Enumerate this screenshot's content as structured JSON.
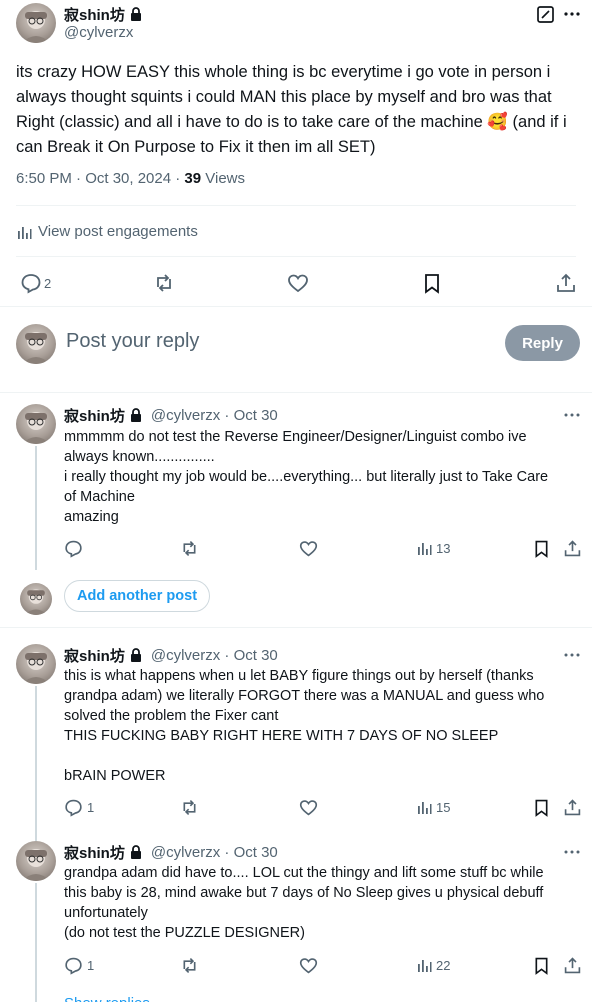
{
  "main_post": {
    "author_name": "寂shin坊",
    "author_handle": "@cylverzx",
    "text": "its crazy HOW EASY this whole thing is bc everytime i go vote in person i always thought squints i could MAN this place by myself and bro was that Right (classic) and all i have to do is to take care of the machine 🥰 (and if i can Break it On Purpose to Fix it then im all SET)",
    "timestamp": "6:50 PM · Oct 30, 2024 · ",
    "views_count": "39",
    "views_label": " Views",
    "engagements_label": "View post engagements",
    "reply_count": "2"
  },
  "composer": {
    "placeholder": "Post your reply",
    "reply_button": "Reply"
  },
  "replies": [
    {
      "author_name": "寂shin坊",
      "meta": "@cylverzx · Oct 30",
      "text": "mmmmm do not test the Reverse Engineer/Designer/Linguist combo ive\nalways known...............\ni really thought my job would be....everything... but literally just to Take Care\nof Machine\namazing",
      "reply_count": "",
      "views": "13"
    },
    {
      "author_name": "寂shin坊",
      "meta": "@cylverzx · Oct 30",
      "text": "this is what happens when u let BABY figure things out by herself (thanks\ngrandpa adam) we literally FORGOT there was a MANUAL and guess who\nsolved the problem the Fixer cant\nTHIS FUCKING BABY RIGHT HERE WITH 7 DAYS OF NO SLEEP\n\nbRAIN POWER",
      "reply_count": "1",
      "views": "15"
    },
    {
      "author_name": "寂shin坊",
      "meta": "@cylverzx · Oct 30",
      "text": "grandpa adam did have to.... LOL cut the thingy and lift some stuff bc while\nthis baby is 28, mind awake but 7 days of No Sleep gives u physical debuff\nunfortunately\n(do not test the PUZZLE DESIGNER)",
      "reply_count": "1",
      "views": "22"
    }
  ],
  "add_another_post": "Add another post",
  "show_replies": "Show replies",
  "colors": {
    "accent": "#1d9bf0",
    "muted": "#536471",
    "reply_button_bg": "#8b98a5"
  }
}
